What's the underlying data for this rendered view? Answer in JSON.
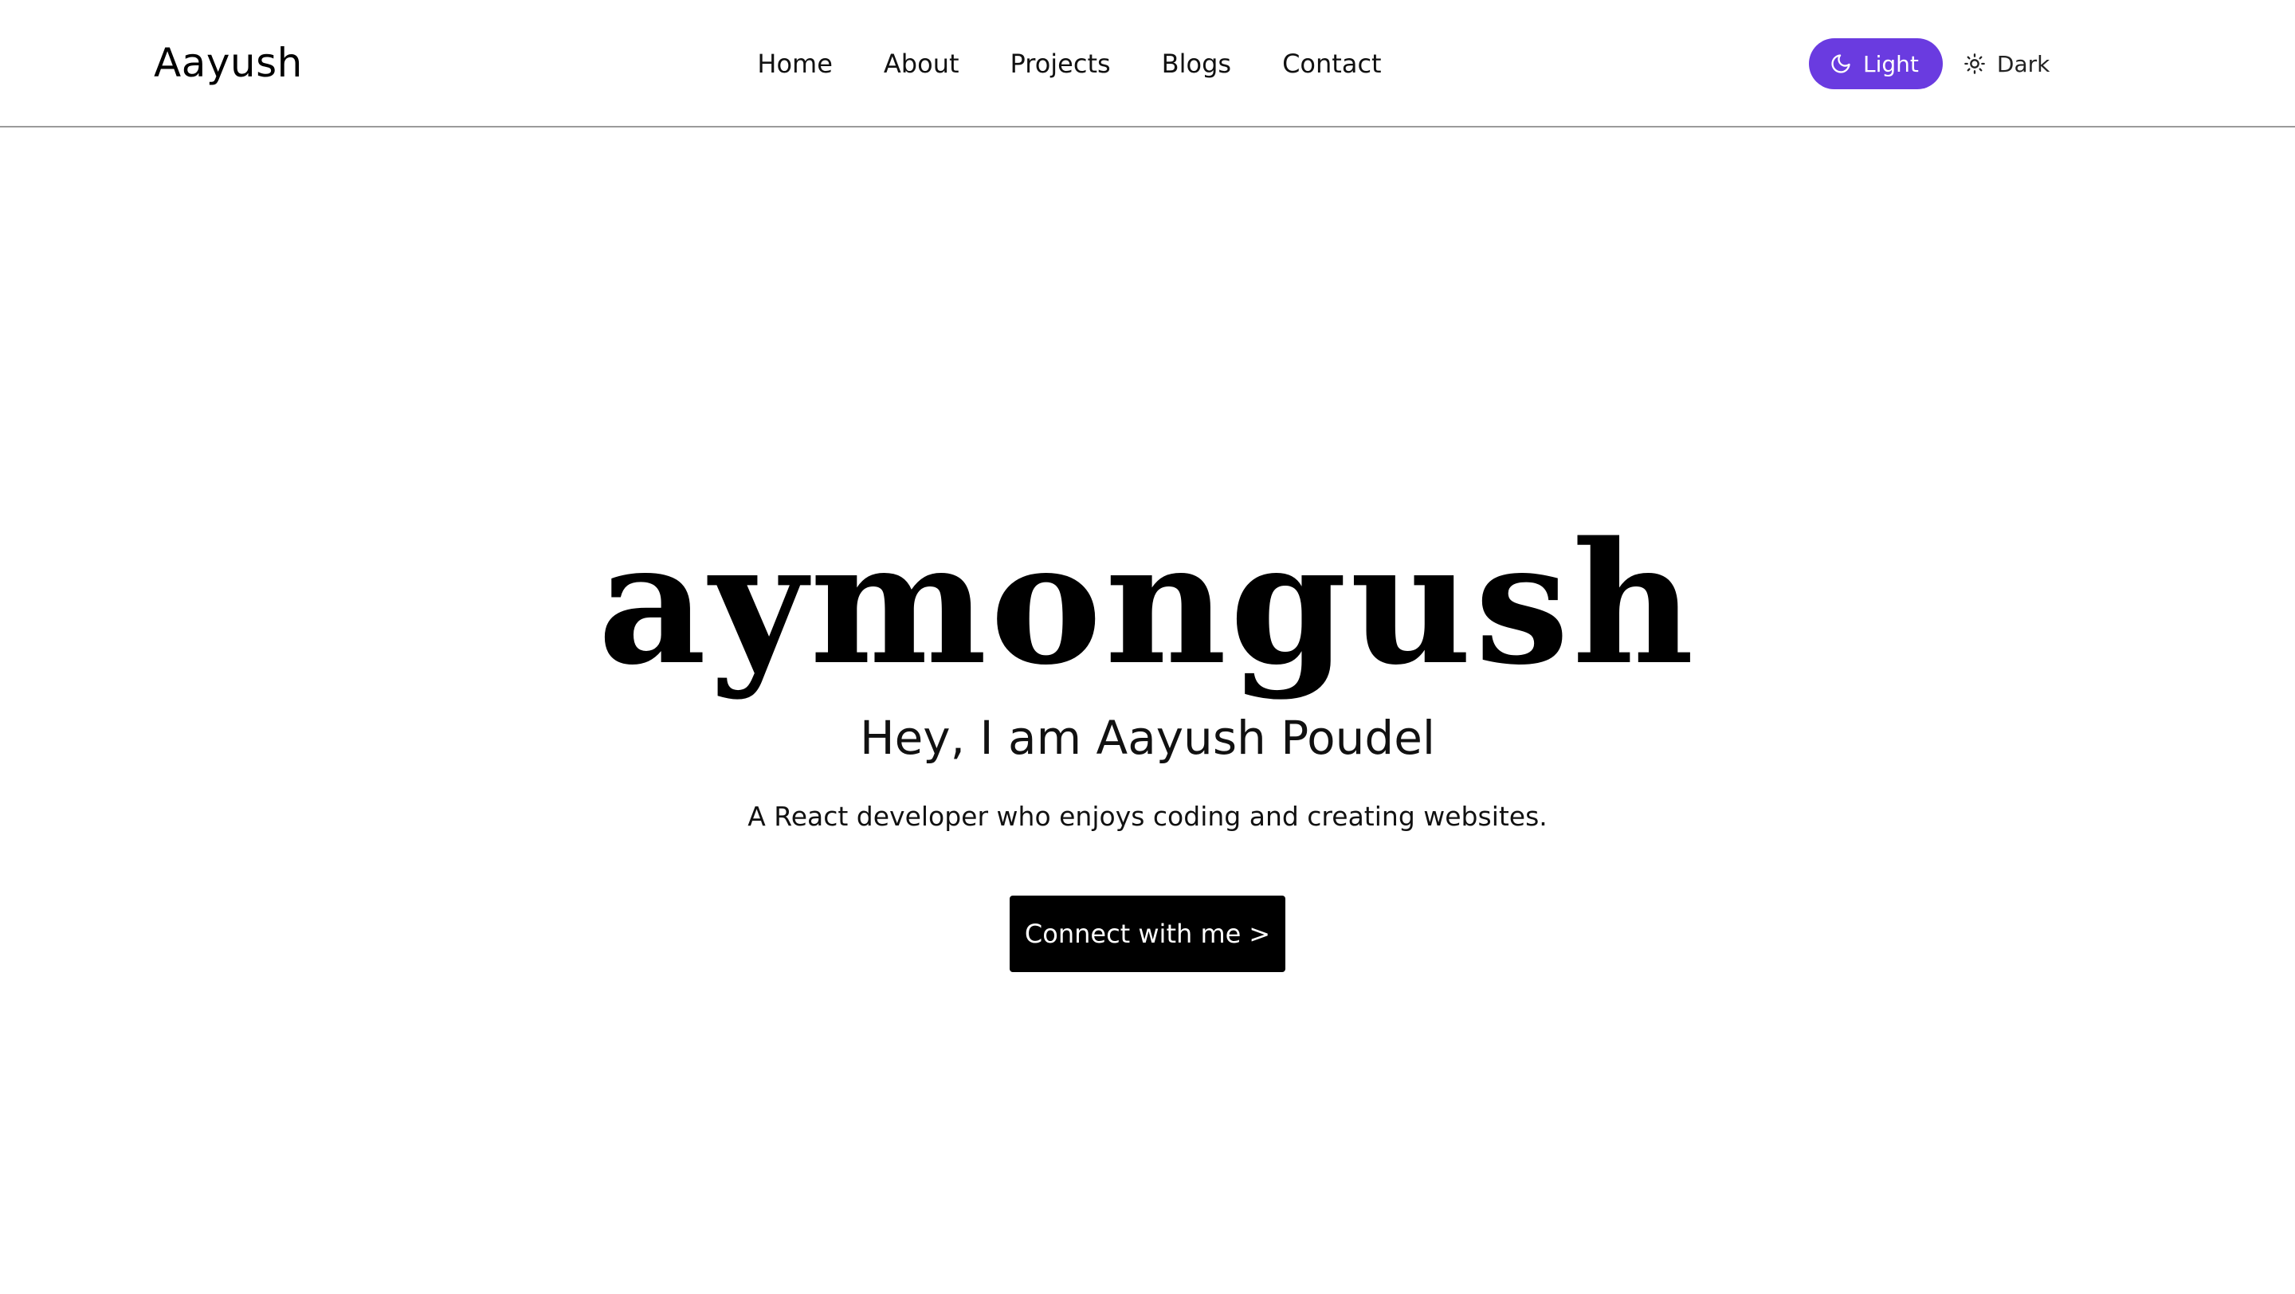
{
  "navbar": {
    "brand": "Aayush",
    "links": [
      {
        "label": "Home"
      },
      {
        "label": "About"
      },
      {
        "label": "Projects"
      },
      {
        "label": "Blogs"
      },
      {
        "label": "Contact"
      }
    ],
    "theme_toggle": {
      "light_label": "Light",
      "light_icon": "moon-icon",
      "dark_label": "Dark",
      "dark_icon": "sun-icon",
      "active": "Light",
      "active_color": "#6a3be0"
    }
  },
  "hero": {
    "title": "aymongush",
    "subtitle": "Hey, I am Aayush Poudel",
    "description": "A React developer who enjoys coding and creating websites.",
    "cta_label": "Connect with me",
    "cta_arrow": ">"
  }
}
